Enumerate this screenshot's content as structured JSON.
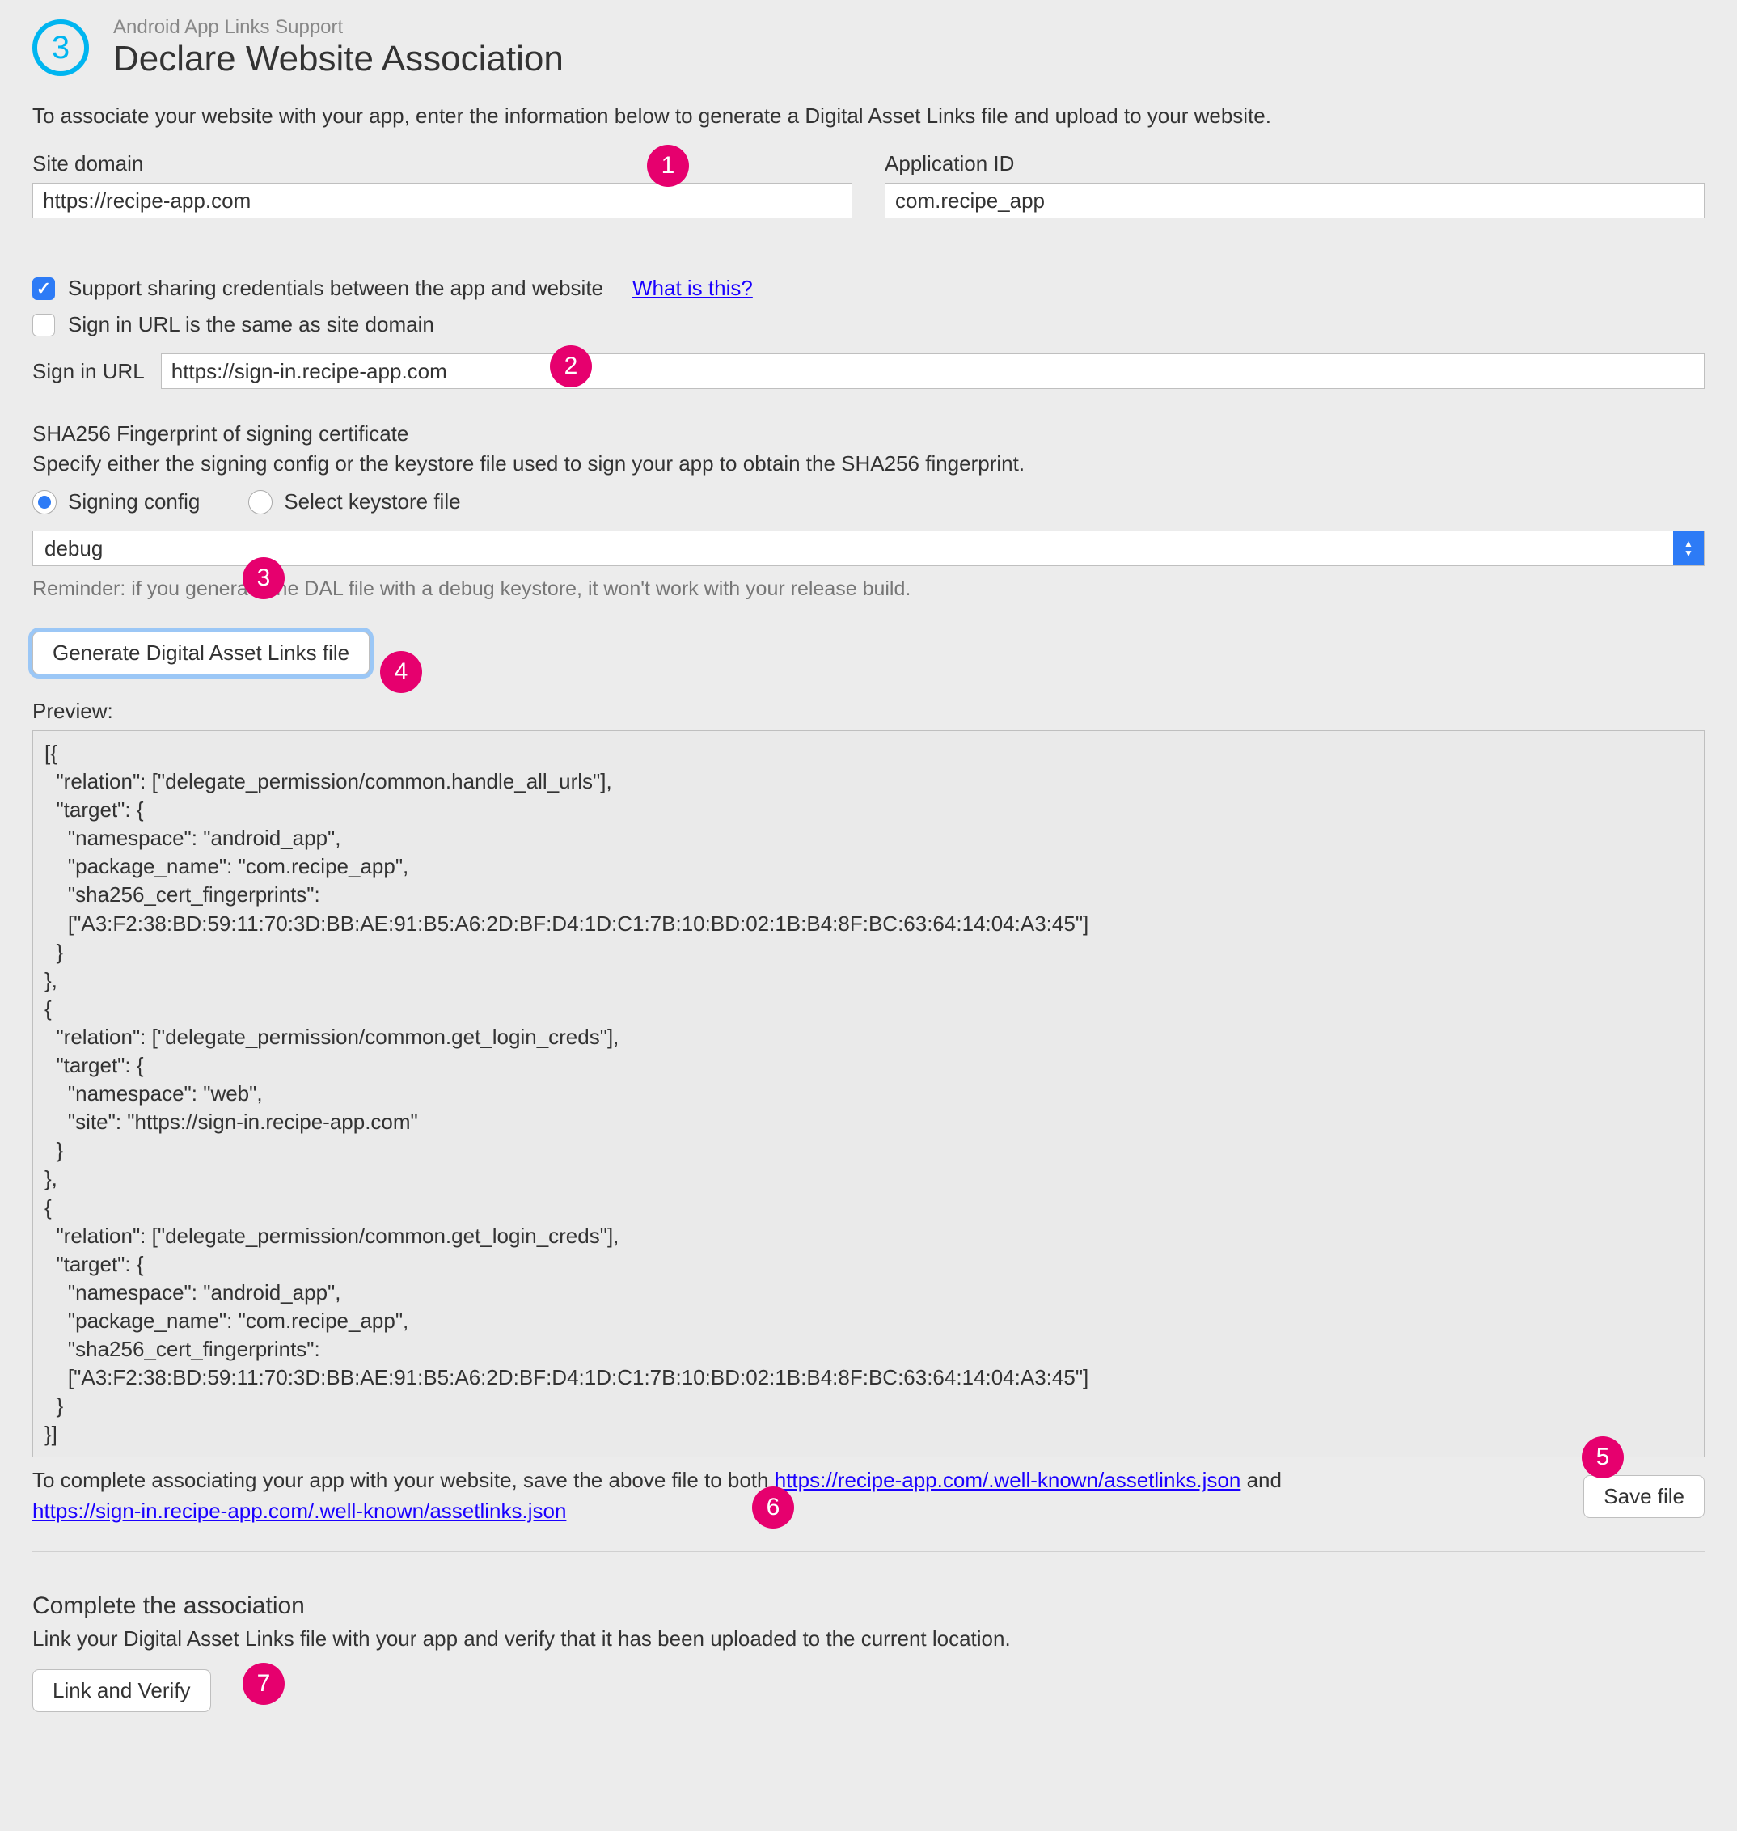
{
  "step_number": "3",
  "breadcrumb": "Android App Links Support",
  "title": "Declare Website Association",
  "intro": "To associate your website with your app, enter the information below to generate a Digital Asset Links file and upload to your website.",
  "site_domain": {
    "label": "Site domain",
    "value": "https://recipe-app.com"
  },
  "application_id": {
    "label": "Application ID",
    "value": "com.recipe_app"
  },
  "share_creds": {
    "label": "Support sharing credentials between the app and website",
    "link": "What is this?",
    "checked": true
  },
  "same_as_domain": {
    "label": "Sign in URL is the same as site domain",
    "checked": false
  },
  "signin_url": {
    "label": "Sign in URL",
    "value": "https://sign-in.recipe-app.com"
  },
  "sha": {
    "title": "SHA256 Fingerprint of signing certificate",
    "desc": "Specify either the signing config or the keystore file used to sign your app to obtain the SHA256 fingerprint.",
    "radio_signing": "Signing config",
    "radio_keystore": "Select keystore file",
    "select_value": "debug",
    "reminder": "Reminder: if you generate the DAL file with a debug keystore, it won't work with your release build."
  },
  "generate_btn": "Generate Digital Asset Links file",
  "preview_label": "Preview:",
  "preview_text": "[{\n  \"relation\": [\"delegate_permission/common.handle_all_urls\"],\n  \"target\": {\n    \"namespace\": \"android_app\",\n    \"package_name\": \"com.recipe_app\",\n    \"sha256_cert_fingerprints\":\n    [\"A3:F2:38:BD:59:11:70:3D:BB:AE:91:B5:A6:2D:BF:D4:1D:C1:7B:10:BD:02:1B:B4:8F:BC:63:64:14:04:A3:45\"]\n  }\n},\n{\n  \"relation\": [\"delegate_permission/common.get_login_creds\"],\n  \"target\": {\n    \"namespace\": \"web\",\n    \"site\": \"https://sign-in.recipe-app.com\"\n  }\n},\n{\n  \"relation\": [\"delegate_permission/common.get_login_creds\"],\n  \"target\": {\n    \"namespace\": \"android_app\",\n    \"package_name\": \"com.recipe_app\",\n    \"sha256_cert_fingerprints\":\n    [\"A3:F2:38:BD:59:11:70:3D:BB:AE:91:B5:A6:2D:BF:D4:1D:C1:7B:10:BD:02:1B:B4:8F:BC:63:64:14:04:A3:45\"]\n  }\n}]",
  "save_instr": {
    "prefix": "To complete associating your app with your website, save the above file to both ",
    "link1": "https://recipe-app.com/.well-known/assetlinks.json",
    "middle": " and ",
    "link2": "https://sign-in.recipe-app.com/.well-known/assetlinks.json"
  },
  "save_btn": "Save file",
  "complete": {
    "title": "Complete the association",
    "desc": "Link your Digital Asset Links file with your app and verify that it has been uploaded to the current location.",
    "btn": "Link and Verify"
  },
  "callouts": {
    "c1": "1",
    "c2": "2",
    "c3": "3",
    "c4": "4",
    "c5": "5",
    "c6": "6",
    "c7": "7"
  }
}
